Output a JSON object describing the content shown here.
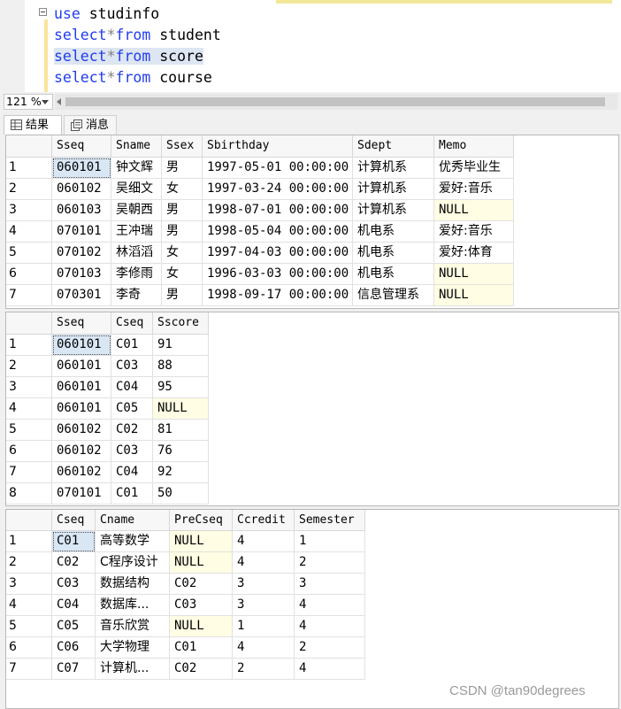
{
  "editor": {
    "lines": [
      [
        {
          "t": "use",
          "c": "kw"
        },
        {
          "t": " studinfo",
          "c": "id"
        }
      ],
      [
        {
          "t": "select",
          "c": "kw"
        },
        {
          "t": "*",
          "c": "op"
        },
        {
          "t": "from",
          "c": "kw"
        },
        {
          "t": " student",
          "c": "id"
        }
      ],
      [
        {
          "t": "select",
          "c": "kw"
        },
        {
          "t": "*",
          "c": "op"
        },
        {
          "t": "from",
          "c": "kw"
        },
        {
          "t": " score",
          "c": "id"
        }
      ],
      [
        {
          "t": "select",
          "c": "kw"
        },
        {
          "t": "*",
          "c": "op"
        },
        {
          "t": "from",
          "c": "kw"
        },
        {
          "t": " course",
          "c": "id"
        }
      ]
    ],
    "highlighted_line": 2
  },
  "zoom": {
    "value": "121 %"
  },
  "tabs": {
    "results": "结果",
    "messages": "消息"
  },
  "grids": [
    {
      "name": "student",
      "columns": [
        "Sseq",
        "Sname",
        "Ssex",
        "Sbirthday",
        "Sdept",
        "Memo"
      ],
      "rows": [
        [
          "060101",
          "钟文辉",
          "男",
          "1997-05-01 00:00:00",
          "计算机系",
          "优秀毕业生"
        ],
        [
          "060102",
          "吴细文",
          "女",
          "1997-03-24 00:00:00",
          "计算机系",
          "爱好:音乐"
        ],
        [
          "060103",
          "吴朝西",
          "男",
          "1998-07-01 00:00:00",
          "计算机系",
          "NULL"
        ],
        [
          "070101",
          "王冲瑞",
          "男",
          "1998-05-04 00:00:00",
          "机电系",
          "爱好:音乐"
        ],
        [
          "070102",
          "林滔滔",
          "女",
          "1997-04-03 00:00:00",
          "机电系",
          "爱好:体育"
        ],
        [
          "070103",
          "李修雨",
          "女",
          "1996-03-03 00:00:00",
          "机电系",
          "NULL"
        ],
        [
          "070301",
          "李奇",
          "男",
          "1998-09-17 00:00:00",
          "信息管理系",
          "NULL"
        ]
      ]
    },
    {
      "name": "score",
      "columns": [
        "Sseq",
        "Cseq",
        "Sscore"
      ],
      "rows": [
        [
          "060101",
          "C01",
          "91"
        ],
        [
          "060101",
          "C03",
          "88"
        ],
        [
          "060101",
          "C04",
          "95"
        ],
        [
          "060101",
          "C05",
          "NULL"
        ],
        [
          "060102",
          "C02",
          "81"
        ],
        [
          "060102",
          "C03",
          "76"
        ],
        [
          "060102",
          "C04",
          "92"
        ],
        [
          "070101",
          "C01",
          "50"
        ]
      ]
    },
    {
      "name": "course",
      "columns": [
        "Cseq",
        "Cname",
        "PreCseq",
        "Ccredit",
        "Semester"
      ],
      "rows": [
        [
          "C01",
          "高等数学",
          "NULL",
          "4",
          "1"
        ],
        [
          "C02",
          "C程序设计",
          "NULL",
          "4",
          "2"
        ],
        [
          "C03",
          "数据结构",
          "C02",
          "3",
          "3"
        ],
        [
          "C04",
          "数据库...",
          "C03",
          "3",
          "4"
        ],
        [
          "C05",
          "音乐欣赏",
          "NULL",
          "1",
          "4"
        ],
        [
          "C06",
          "大学物理",
          "C01",
          "4",
          "2"
        ],
        [
          "C07",
          "计算机...",
          "C02",
          "2",
          "4"
        ]
      ]
    }
  ],
  "watermark": "CSDN @tan90degrees",
  "colors": {
    "keyword": "#1f3cf0",
    "null_bg": "#fffde3",
    "selected_bg": "#d9e7f5"
  }
}
